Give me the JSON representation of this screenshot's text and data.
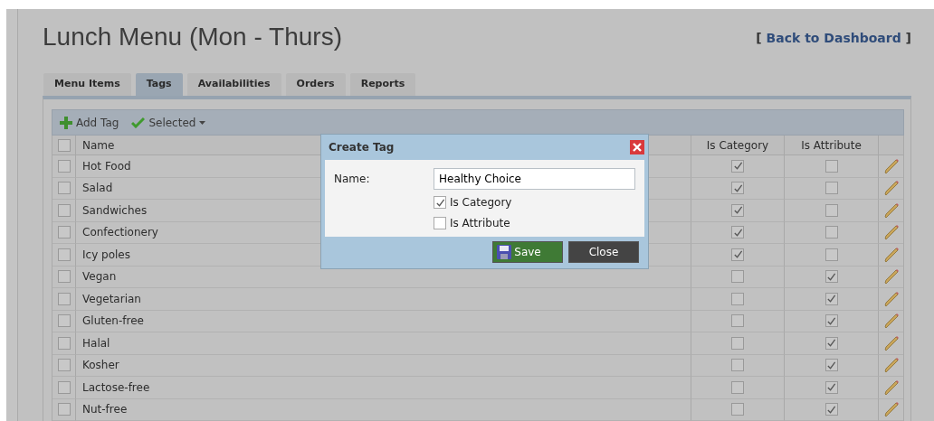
{
  "page": {
    "title": "Lunch Menu (Mon - Thurs)",
    "back_link": {
      "open": "[",
      "text": "Back to Dashboard",
      "close": "]"
    }
  },
  "tabs": [
    {
      "label": "Menu Items",
      "selected": false
    },
    {
      "label": "Tags",
      "selected": true
    },
    {
      "label": "Availabilities",
      "selected": false
    },
    {
      "label": "Orders",
      "selected": false
    },
    {
      "label": "Reports",
      "selected": false
    }
  ],
  "toolbar": [
    {
      "kind": "add",
      "label": "Add Tag"
    },
    {
      "kind": "selected",
      "label": "Selected"
    }
  ],
  "table": {
    "select_all": false,
    "columns": [
      "Name",
      "Is Category",
      "Is Attribute"
    ],
    "rows": [
      {
        "name": "Hot Food",
        "selected": false,
        "is_category": true,
        "is_attribute": false
      },
      {
        "name": "Salad",
        "selected": false,
        "is_category": true,
        "is_attribute": false
      },
      {
        "name": "Sandwiches",
        "selected": false,
        "is_category": true,
        "is_attribute": false
      },
      {
        "name": "Confectionery",
        "selected": false,
        "is_category": true,
        "is_attribute": false
      },
      {
        "name": "Icy poles",
        "selected": false,
        "is_category": true,
        "is_attribute": false
      },
      {
        "name": "Vegan",
        "selected": false,
        "is_category": false,
        "is_attribute": true
      },
      {
        "name": "Vegetarian",
        "selected": false,
        "is_category": false,
        "is_attribute": true
      },
      {
        "name": "Gluten-free",
        "selected": false,
        "is_category": false,
        "is_attribute": true
      },
      {
        "name": "Halal",
        "selected": false,
        "is_category": false,
        "is_attribute": true
      },
      {
        "name": "Kosher",
        "selected": false,
        "is_category": false,
        "is_attribute": true
      },
      {
        "name": "Lactose-free",
        "selected": false,
        "is_category": false,
        "is_attribute": true
      },
      {
        "name": "Nut-free",
        "selected": false,
        "is_category": false,
        "is_attribute": true
      }
    ]
  },
  "dialog": {
    "title": "Create Tag",
    "name_label": "Name:",
    "name_value": "Healthy Choice",
    "checkboxes": [
      {
        "label": "Is Category",
        "checked": true
      },
      {
        "label": "Is Attribute",
        "checked": false
      }
    ],
    "buttons": [
      {
        "kind": "save",
        "label": "Save"
      },
      {
        "kind": "close",
        "label": "Close"
      }
    ]
  }
}
